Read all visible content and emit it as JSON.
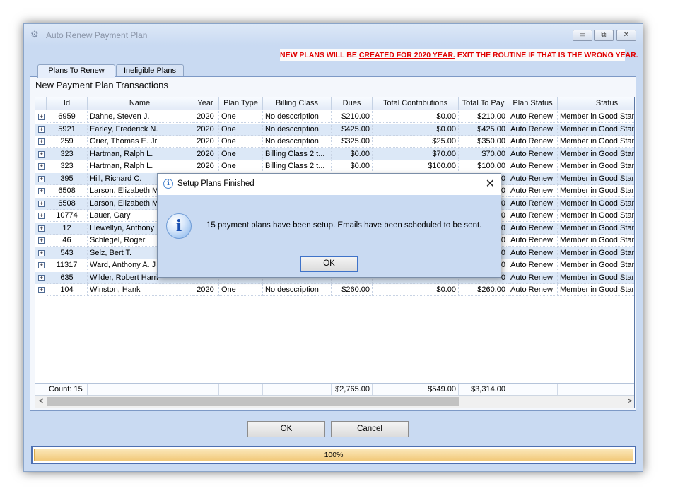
{
  "window": {
    "title": "Auto Renew Payment Plan",
    "controls": {
      "minimize": "▭",
      "restore": "⧉",
      "close": "✕"
    }
  },
  "warning": {
    "part1": "NEW PLANS WILL BE ",
    "part2": "CREATED FOR 2020 YEAR.",
    "part3": " EXIT THE ROUTINE IF THAT IS THE WRONG YEAR."
  },
  "tabs": [
    {
      "label": "Plans To Renew",
      "active": true
    },
    {
      "label": "Ineligible Plans",
      "active": false
    }
  ],
  "panel_title": "New Payment Plan Transactions",
  "grid": {
    "columns": [
      "Id",
      "Name",
      "Year",
      "Plan Type",
      "Billing Class",
      "Dues",
      "Total Contributions",
      "Total To Pay",
      "Plan Status",
      "Status"
    ],
    "rows": [
      [
        "6959",
        "Dahne, Steven J.",
        "2020",
        "One",
        "No desccription",
        "$210.00",
        "$0.00",
        "$210.00",
        "Auto Renew",
        "Member in Good Standing"
      ],
      [
        "5921",
        "Earley, Frederick N.",
        "2020",
        "One",
        "No desccription",
        "$425.00",
        "$0.00",
        "$425.00",
        "Auto Renew",
        "Member in Good Standing"
      ],
      [
        "259",
        "Grier, Thomas E. Jr",
        "2020",
        "One",
        "No desccription",
        "$325.00",
        "$25.00",
        "$350.00",
        "Auto Renew",
        "Member in Good Standing"
      ],
      [
        "323",
        "Hartman, Ralph L.",
        "2020",
        "One",
        "Billing Class 2 t...",
        "$0.00",
        "$70.00",
        "$70.00",
        "Auto Renew",
        "Member in Good Standing"
      ],
      [
        "323",
        "Hartman, Ralph L.",
        "2020",
        "One",
        "Billing Class 2 t...",
        "$0.00",
        "$100.00",
        "$100.00",
        "Auto Renew",
        "Member in Good Standing"
      ],
      [
        "395",
        "Hill, Richard C.",
        "",
        "",
        "",
        "",
        "",
        "0",
        "Auto Renew",
        "Member in Good Standing"
      ],
      [
        "6508",
        "Larson, Elizabeth M",
        "",
        "",
        "",
        "",
        "",
        "0",
        "Auto Renew",
        "Member in Good Standing"
      ],
      [
        "6508",
        "Larson, Elizabeth M",
        "",
        "",
        "",
        "",
        "",
        "0",
        "Auto Renew",
        "Member in Good Standing"
      ],
      [
        "10774",
        "Lauer, Gary",
        "",
        "",
        "",
        "",
        "",
        "0",
        "Auto Renew",
        "Member in Good Standing"
      ],
      [
        "12",
        "Llewellyn, Anthony",
        "",
        "",
        "",
        "",
        "",
        "0",
        "Auto Renew",
        "Member in Good Standing"
      ],
      [
        "46",
        "Schlegel, Roger",
        "",
        "",
        "",
        "",
        "",
        "0",
        "Auto Renew",
        "Member in Good Standing"
      ],
      [
        "543",
        "Selz, Bert T.",
        "",
        "",
        "",
        "",
        "",
        "0",
        "Auto Renew",
        "Member in Good Standing"
      ],
      [
        "11317",
        "Ward, Anthony A. J",
        "",
        "",
        "",
        "",
        "",
        "0",
        "Auto Renew",
        "Member in Good Standing"
      ],
      [
        "635",
        "Wilder, Robert Harri",
        "",
        "",
        "",
        "",
        "",
        "0",
        "Auto Renew",
        "Member in Good Standing"
      ],
      [
        "104",
        "Winston, Hank",
        "2020",
        "One",
        "No desccription",
        "$260.00",
        "$0.00",
        "$260.00",
        "Auto Renew",
        "Member in Good Standing"
      ]
    ],
    "footer": {
      "count": "Count: 15",
      "dues": "$2,765.00",
      "contributions": "$549.00",
      "total": "$3,314.00"
    }
  },
  "buttons": {
    "ok": "OK",
    "cancel": "Cancel"
  },
  "progress": {
    "label": "100%",
    "value": 1.0
  },
  "dialog": {
    "title": "Setup Plans Finished",
    "message": "15 payment plans have been setup. Emails have been scheduled to be sent.",
    "ok": "OK",
    "close": "✕",
    "icon_glyph": "i"
  },
  "icons": {
    "expander": "+",
    "scroll_left": "<",
    "scroll_right": ">",
    "window_icon": "⚙"
  }
}
